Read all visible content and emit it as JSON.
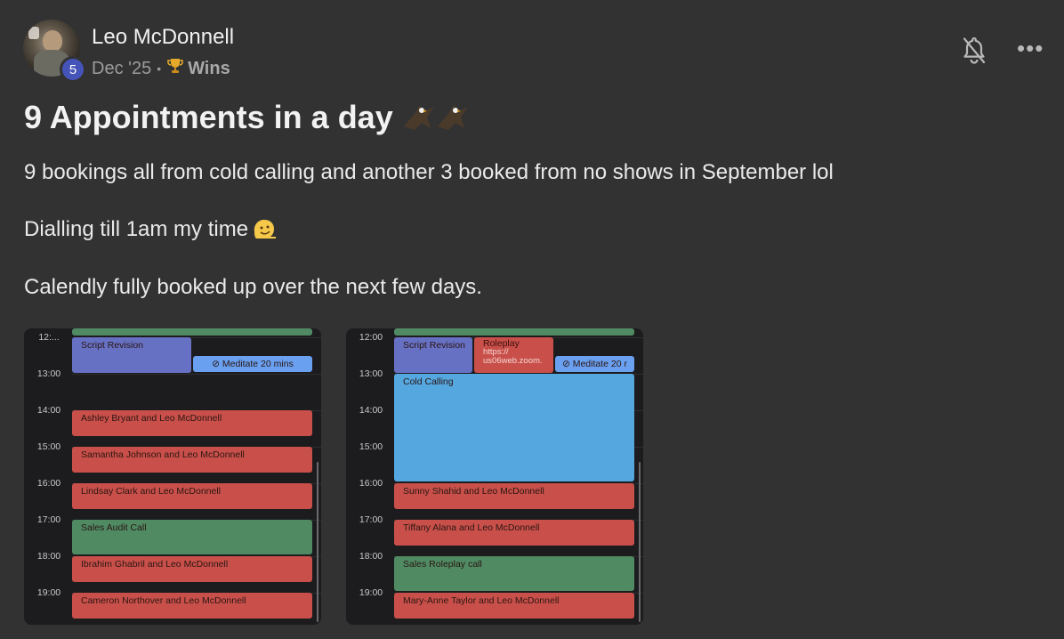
{
  "post": {
    "author": "Leo McDonnell",
    "level": "5",
    "date": "Dec '25",
    "separator": "•",
    "category": "Wins",
    "title": "9 Appointments in a day",
    "paragraphs": [
      "9 bookings all from cold calling and another 3 booked from no shows in September lol",
      "Dialling till 1am my time",
      "Calendly fully booked up over the next few days."
    ]
  },
  "icons": {
    "trophy": "trophy-icon",
    "bell": "bell-off-icon",
    "more": "more-options-icon",
    "eagle": "eagle-emoji",
    "face": "melting-face-emoji"
  },
  "calendar1": {
    "times": [
      "12:...",
      "13:00",
      "14:00",
      "15:00",
      "16:00",
      "17:00",
      "18:00",
      "19:00"
    ],
    "events": {
      "script_revision": "Script Revision",
      "meditate": "⊘ Meditate 20 mins",
      "e1": "Ashley Bryant and Leo McDonnell",
      "e2": "Samantha Johnson and Leo McDonnell",
      "e3": "Lindsay Clark and Leo McDonnell",
      "e4": "Sales Audit Call",
      "e5": "Ibrahim Ghabril and Leo McDonnell",
      "e6": "Cameron Northover and Leo McDonnell"
    }
  },
  "calendar2": {
    "times": [
      "12:00",
      "13:00",
      "14:00",
      "15:00",
      "16:00",
      "17:00",
      "18:00",
      "19:00"
    ],
    "events": {
      "script_revision": "Script Revision",
      "roleplay_title": "Roleplay",
      "roleplay_l1": "https://",
      "roleplay_l2": "us06web.zoom.",
      "meditate": "⊘ Meditate 20 r",
      "cold_calling": "Cold Calling",
      "e1": "Sunny Shahid and Leo McDonnell",
      "e2": "Tiffany Alana and Leo McDonnell",
      "e3": "Sales Roleplay call",
      "e4": "Mary-Anne Taylor and Leo McDonnell"
    }
  },
  "colors": {
    "background": "#323232",
    "level_badge": "#4454b8",
    "event_red": "#c9504a",
    "event_green": "#4f8a63",
    "event_purple": "#6771c4",
    "event_light_blue": "#6aa0f0",
    "event_sky": "#55a7df"
  }
}
